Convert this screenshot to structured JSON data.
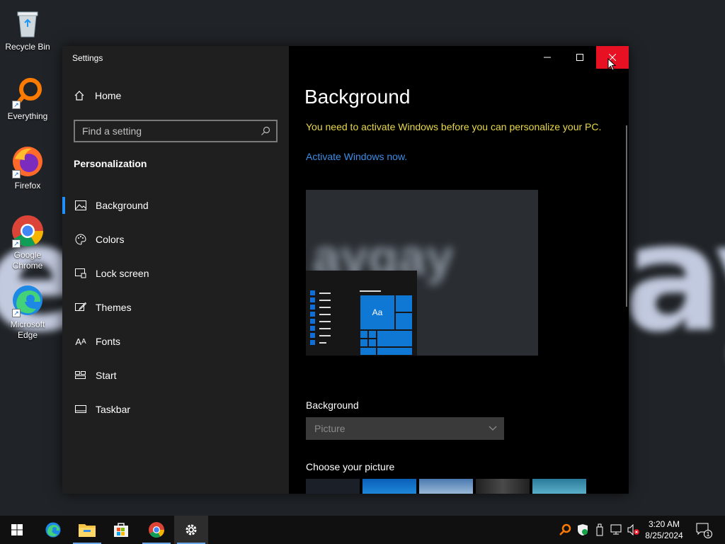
{
  "desktop": {
    "icons": [
      {
        "label": "Recycle Bin",
        "icon": "recycle-bin-icon"
      },
      {
        "label": "Everything",
        "icon": "everything-search-icon"
      },
      {
        "label": "Firefox",
        "icon": "firefox-icon"
      },
      {
        "label": "Google Chrome",
        "icon": "chrome-icon"
      },
      {
        "label": "Microsoft Edge",
        "icon": "edge-icon"
      }
    ]
  },
  "window": {
    "title": "Settings",
    "minimize_icon": "minimize-icon",
    "maximize_icon": "maximize-icon",
    "close_icon": "close-icon"
  },
  "sidebar": {
    "home_label": "Home",
    "search_placeholder": "Find a setting",
    "section_title": "Personalization",
    "items": [
      {
        "label": "Background",
        "icon": "picture-icon",
        "active": true
      },
      {
        "label": "Colors",
        "icon": "palette-icon",
        "active": false
      },
      {
        "label": "Lock screen",
        "icon": "lock-screen-icon",
        "active": false
      },
      {
        "label": "Themes",
        "icon": "themes-brush-icon",
        "active": false
      },
      {
        "label": "Fonts",
        "icon": "fonts-icon",
        "active": false
      },
      {
        "label": "Start",
        "icon": "start-icon",
        "active": false
      },
      {
        "label": "Taskbar",
        "icon": "taskbar-icon",
        "active": false
      }
    ]
  },
  "content": {
    "title": "Background",
    "warning": "You need to activate Windows before you can personalize your PC.",
    "activate_link": "Activate Windows now.",
    "preview_tile_text": "Aa",
    "background_label": "Background",
    "background_value": "Picture",
    "choose_label": "Choose your picture"
  },
  "taskbar": {
    "apps": [
      "start-icon",
      "edge-icon",
      "file-explorer-icon",
      "store-icon",
      "chrome-icon",
      "settings-gear-icon"
    ],
    "time": "3:20 AM",
    "date": "8/25/2024",
    "notification_count": "1"
  },
  "colors": {
    "accent": "#0f78d4",
    "close_red": "#e81123",
    "warning_yellow": "#e8d84a",
    "link_blue": "#3b8ee8"
  }
}
